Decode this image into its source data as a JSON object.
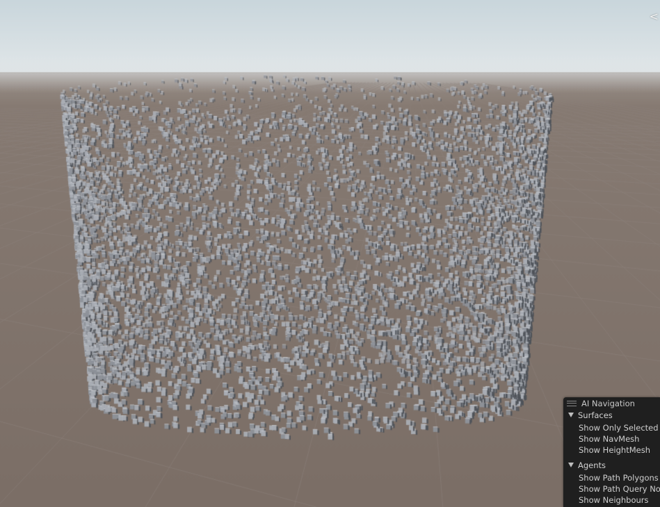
{
  "scene": {
    "sky_color_top": "#c9d6dc",
    "sky_color_horizon": "#e3e8ea",
    "ground_color": "#7b6e66",
    "grid_line_color": "#8d827b",
    "cube_color_light": "#a9adb4",
    "cube_color_dark": "#4f535a"
  },
  "orientation_gizmo": {
    "glyph": "<",
    "icon": "scene-orientation-gizmo-icon"
  },
  "nav_panel": {
    "title": "AI Navigation",
    "handle_icon": "drag-handle-icon",
    "sections": [
      {
        "label": "Surfaces",
        "expanded": true,
        "options": [
          "Show Only Selected",
          "Show NavMesh",
          "Show HeightMesh"
        ]
      },
      {
        "label": "Agents",
        "expanded": true,
        "options": [
          "Show Path Polygons",
          "Show Path Query No",
          "Show Neighbours"
        ]
      }
    ]
  }
}
